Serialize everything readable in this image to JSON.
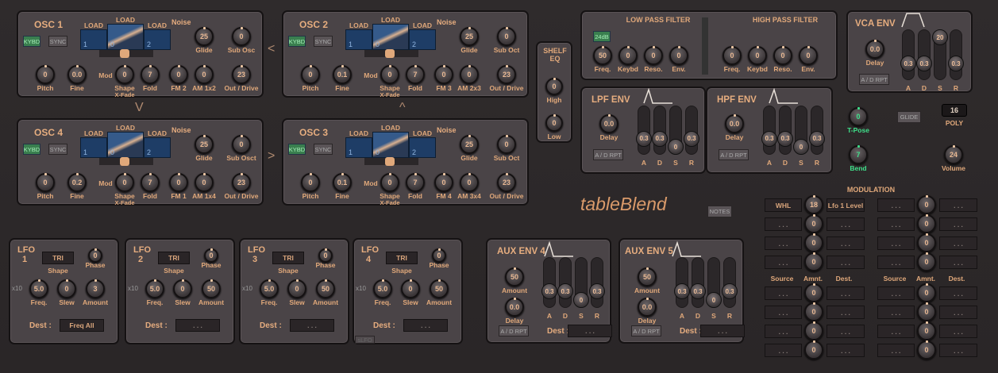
{
  "colors": {
    "background": "#2d292a",
    "panel": "#4a4447",
    "accent": "#e0a87a",
    "active_button": "#3a7f4f",
    "wave_display": "#1e3d66",
    "green_knob": "#3fe08a"
  },
  "app_title": "tableBlend",
  "notes_button": "NOTES",
  "arrows": [
    "<",
    "V",
    "^",
    ">"
  ],
  "oscillators": [
    {
      "title": "OSC  1",
      "kybd": "KYBD",
      "kybd_on": true,
      "sync": "SYNC",
      "load": [
        "LOAD",
        "LOAD",
        "LOAD"
      ],
      "tables": [
        "1",
        "0",
        "2"
      ],
      "noise": "Noise",
      "mod": "Mod",
      "xfade": "X-Fade",
      "knobs": [
        {
          "label": "Glide",
          "value": "25"
        },
        {
          "label": "Sub Osc",
          "value": "0"
        },
        {
          "label": "Pitch",
          "value": "0"
        },
        {
          "label": "Fine",
          "value": "0.0"
        },
        {
          "label": "Shape",
          "value": "0"
        },
        {
          "label": "Fold",
          "value": "7"
        },
        {
          "label": "FM  2",
          "value": "0"
        },
        {
          "label": "AM 1x2",
          "value": "0"
        },
        {
          "label": "Out / Drive",
          "value": "23"
        }
      ]
    },
    {
      "title": "OSC  2",
      "kybd": "KYBD",
      "kybd_on": true,
      "sync": "SYNC",
      "load": [
        "LOAD",
        "LOAD",
        "LOAD"
      ],
      "tables": [
        "1",
        "0",
        "2"
      ],
      "noise": "Noise",
      "mod": "Mod",
      "xfade": "X-Fade",
      "knobs": [
        {
          "label": "Glide",
          "value": "25"
        },
        {
          "label": "Sub Oct",
          "value": "0"
        },
        {
          "label": "Pitch",
          "value": "0"
        },
        {
          "label": "Fine",
          "value": "0.1"
        },
        {
          "label": "Shape",
          "value": "0"
        },
        {
          "label": "Fold",
          "value": "7"
        },
        {
          "label": "FM  3",
          "value": "0"
        },
        {
          "label": "AM 2x3",
          "value": "0"
        },
        {
          "label": "Out / Drive",
          "value": "23"
        }
      ]
    },
    {
      "title": "OSC  4",
      "kybd": "KYBD",
      "kybd_on": true,
      "sync": "SYNC",
      "load": [
        "LOAD",
        "LOAD",
        "LOAD"
      ],
      "tables": [
        "1",
        "0",
        "2"
      ],
      "noise": "Noise",
      "mod": "Mod",
      "xfade": "X-Fade",
      "knobs": [
        {
          "label": "Glide",
          "value": "25"
        },
        {
          "label": "Sub Osct",
          "value": "0"
        },
        {
          "label": "Pitch",
          "value": "0"
        },
        {
          "label": "Fine",
          "value": "0.2"
        },
        {
          "label": "Shape",
          "value": "0"
        },
        {
          "label": "Fold",
          "value": "7"
        },
        {
          "label": "FM  1",
          "value": "0"
        },
        {
          "label": "AM 1x4",
          "value": "0"
        },
        {
          "label": "Out / Drive",
          "value": "23"
        }
      ]
    },
    {
      "title": "OSC  3",
      "kybd": "KYBD",
      "kybd_on": true,
      "sync": "SYNC",
      "load": [
        "LOAD",
        "LOAD",
        "LOAD"
      ],
      "tables": [
        "1",
        "0",
        "2"
      ],
      "noise": "Noise",
      "mod": "Mod",
      "xfade": "X-Fade",
      "knobs": [
        {
          "label": "Glide",
          "value": "25"
        },
        {
          "label": "Sub Oct",
          "value": "0"
        },
        {
          "label": "Pitch",
          "value": "0"
        },
        {
          "label": "Fine",
          "value": "0.1"
        },
        {
          "label": "Shape",
          "value": "0"
        },
        {
          "label": "Fold",
          "value": "7"
        },
        {
          "label": "FM  4",
          "value": "0"
        },
        {
          "label": "AM 3x4",
          "value": "0"
        },
        {
          "label": "Out / Drive",
          "value": "23"
        }
      ]
    }
  ],
  "shelf_eq": {
    "title": "SHELF EQ",
    "knobs": [
      {
        "label": "High",
        "value": "0"
      },
      {
        "label": "Low",
        "value": "0"
      }
    ]
  },
  "filters": {
    "lpf": {
      "title": "LOW PASS FILTER",
      "mode": "24dB",
      "knobs": [
        {
          "label": "Freq.",
          "value": "50"
        },
        {
          "label": "Keybd",
          "value": "0"
        },
        {
          "label": "Reso.",
          "value": "0"
        },
        {
          "label": "Env.",
          "value": "0"
        }
      ]
    },
    "hpf": {
      "title": "HIGH PASS FILTER",
      "knobs": [
        {
          "label": "Freq.",
          "value": "0"
        },
        {
          "label": "Keybd",
          "value": "0"
        },
        {
          "label": "Reso.",
          "value": "0"
        },
        {
          "label": "Env.",
          "value": "0"
        }
      ]
    }
  },
  "envelopes": {
    "vca": {
      "title": "VCA ENV",
      "delay": {
        "label": "Delay",
        "value": "0.0"
      },
      "rpt": "A / D RPT",
      "adsr": [
        {
          "label": "A",
          "value": "0.3",
          "level": 0.25
        },
        {
          "label": "D",
          "value": "0.3",
          "level": 0.25
        },
        {
          "label": "S",
          "value": "20",
          "level": 1
        },
        {
          "label": "R",
          "value": "0.3",
          "level": 0.25
        }
      ]
    },
    "lpf": {
      "title": "LPF  ENV",
      "delay": {
        "label": "Delay",
        "value": "0.0"
      },
      "rpt": "A / D RPT",
      "adsr": [
        {
          "label": "A",
          "value": "0.3",
          "level": 0.25
        },
        {
          "label": "D",
          "value": "0.3",
          "level": 0.25
        },
        {
          "label": "S",
          "value": "0",
          "level": 0
        },
        {
          "label": "R",
          "value": "0.3",
          "level": 0.25
        }
      ]
    },
    "hpf": {
      "title": "HPF  ENV",
      "delay": {
        "label": "Delay",
        "value": "0.0"
      },
      "rpt": "A / D RPT",
      "adsr": [
        {
          "label": "A",
          "value": "0.3",
          "level": 0.25
        },
        {
          "label": "D",
          "value": "0.3",
          "level": 0.25
        },
        {
          "label": "S",
          "value": "0",
          "level": 0
        },
        {
          "label": "R",
          "value": "0.3",
          "level": 0.25
        }
      ]
    },
    "aux4": {
      "title": "AUX ENV 4",
      "amount": {
        "label": "Amount",
        "value": "50"
      },
      "delay": {
        "label": "Delay",
        "value": "0.0"
      },
      "rpt": "A / D RPT",
      "dest_label": "Dest :",
      "dest": ". . .",
      "adsr": [
        {
          "label": "A",
          "value": "0.3",
          "level": 0.25
        },
        {
          "label": "D",
          "value": "0.3",
          "level": 0.25
        },
        {
          "label": "S",
          "value": "0",
          "level": 0
        },
        {
          "label": "R",
          "value": "0.3",
          "level": 0.25
        }
      ]
    },
    "aux5": {
      "title": "AUX ENV 5",
      "amount": {
        "label": "Amount",
        "value": "50"
      },
      "delay": {
        "label": "Delay",
        "value": "0.0"
      },
      "rpt": "A / D RPT",
      "dest_label": "Dest :",
      "dest": ". . .",
      "adsr": [
        {
          "label": "A",
          "value": "0.3",
          "level": 0.25
        },
        {
          "label": "D",
          "value": "0.3",
          "level": 0.25
        },
        {
          "label": "S",
          "value": "0",
          "level": 0
        },
        {
          "label": "R",
          "value": "0.3",
          "level": 0.25
        }
      ]
    }
  },
  "global": {
    "tpose": {
      "label": "T-Pose",
      "value": "0"
    },
    "bend": {
      "label": "Bend",
      "value": "7"
    },
    "glide_button": "GLIDE",
    "poly": {
      "label": "POLY",
      "value": "16"
    },
    "volume": {
      "label": "Volume",
      "value": "24"
    }
  },
  "lfos": [
    {
      "title": "LFO",
      "number": "1",
      "shape": "TRI",
      "shape_label": "Shape",
      "phase": {
        "label": "Phase",
        "value": "0"
      },
      "x10": "x10",
      "freq": {
        "label": "Freq.",
        "value": "5.0"
      },
      "slew": {
        "label": "Slew",
        "value": "0"
      },
      "amount": {
        "label": "Amount",
        "value": "3"
      },
      "dest_label": "Dest :",
      "dest": "Freq All"
    },
    {
      "title": "LFO",
      "number": "2",
      "shape": "TRI",
      "shape_label": "Shape",
      "phase": {
        "label": "Phase",
        "value": "0"
      },
      "x10": "x10",
      "freq": {
        "label": "Freq.",
        "value": "5.0"
      },
      "slew": {
        "label": "Slew",
        "value": "0"
      },
      "amount": {
        "label": "Amount",
        "value": "50"
      },
      "dest_label": "Dest :",
      "dest": ". . ."
    },
    {
      "title": "LFO",
      "number": "3",
      "shape": "TRI",
      "shape_label": "Shape",
      "phase": {
        "label": "Phase",
        "value": "0"
      },
      "x10": "x10",
      "freq": {
        "label": "Freq.",
        "value": "5.0"
      },
      "slew": {
        "label": "Slew",
        "value": "0"
      },
      "amount": {
        "label": "Amount",
        "value": "50"
      },
      "dest_label": "Dest :",
      "dest": ". . ."
    },
    {
      "title": "LFO",
      "number": "4",
      "shape": "TRI",
      "shape_label": "Shape",
      "phase": {
        "label": "Phase",
        "value": "0"
      },
      "x10": "x10",
      "freq": {
        "label": "Freq.",
        "value": "5.0"
      },
      "slew": {
        "label": "Slew",
        "value": "0"
      },
      "amount": {
        "label": "Amount",
        "value": "50"
      },
      "dest_label": "Dest :",
      "dest": ". . ."
    }
  ],
  "slfo_button": "sLFO",
  "modulation": {
    "title": "MODULATION",
    "headers": [
      "Source",
      "Amnt.",
      "Dest."
    ],
    "slots": [
      {
        "source": "WHL",
        "amount": "18",
        "dest": "Lfo 1 Level"
      },
      {
        "source": ". . .",
        "amount": "0",
        "dest": ". . ."
      },
      {
        "source": ". . .",
        "amount": "0",
        "dest": ". . ."
      },
      {
        "source": ". . .",
        "amount": "0",
        "dest": ". . ."
      },
      {
        "source": ". . .",
        "amount": "0",
        "dest": ". . ."
      },
      {
        "source": ". . .",
        "amount": "0",
        "dest": ". . ."
      },
      {
        "source": ". . .",
        "amount": "0",
        "dest": ". . ."
      },
      {
        "source": ". . .",
        "amount": "0",
        "dest": ". . ."
      },
      {
        "source": ". . .",
        "amount": "0",
        "dest": ". . ."
      },
      {
        "source": ". . .",
        "amount": "0",
        "dest": ". . ."
      },
      {
        "source": ". . .",
        "amount": "0",
        "dest": ". . ."
      },
      {
        "source": ". . .",
        "amount": "0",
        "dest": ". . ."
      },
      {
        "source": ". . .",
        "amount": "0",
        "dest": ". . ."
      },
      {
        "source": ". . .",
        "amount": "0",
        "dest": ". . ."
      },
      {
        "source": ". . .",
        "amount": "0",
        "dest": ". . ."
      },
      {
        "source": ". . .",
        "amount": "0",
        "dest": ". . ."
      }
    ]
  }
}
